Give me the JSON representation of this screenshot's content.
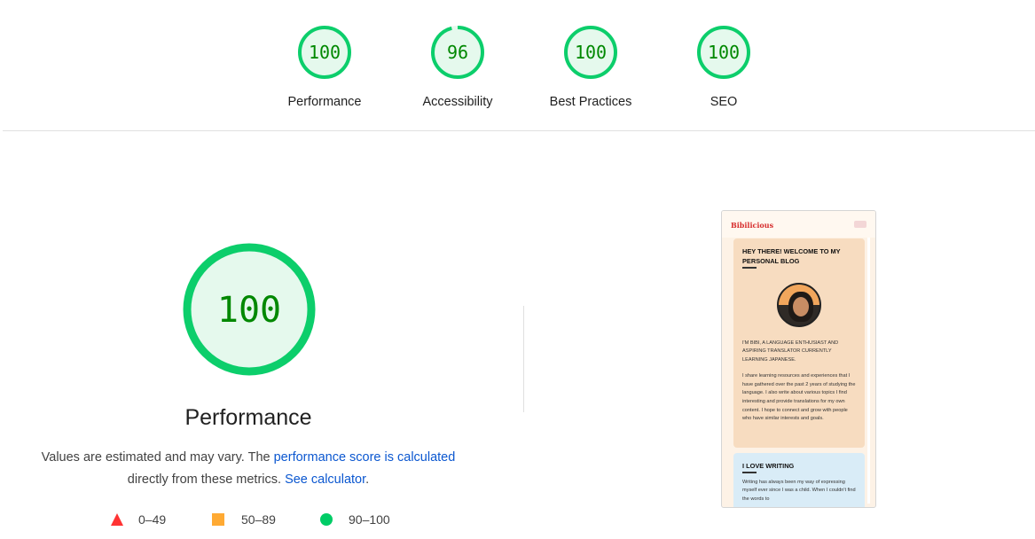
{
  "top_scores": [
    {
      "label": "Performance",
      "score": "100",
      "value": 100
    },
    {
      "label": "Accessibility",
      "score": "96",
      "value": 96
    },
    {
      "label": "Best Practices",
      "score": "100",
      "value": 100
    },
    {
      "label": "SEO",
      "score": "100",
      "value": 100
    }
  ],
  "main": {
    "score": "100",
    "value": 100,
    "title": "Performance",
    "desc_prefix": "Values are estimated and may vary. The ",
    "desc_link1": "performance score is calculated",
    "desc_middle": " directly from these metrics. ",
    "desc_link2": "See calculator",
    "desc_suffix": "."
  },
  "legend": {
    "fail": "0–49",
    "average": "50–89",
    "pass": "90–100"
  },
  "colors": {
    "pass": "#0cce6b",
    "pass_bg": "#e5f9ed",
    "pass_text": "#008800",
    "fail": "#ff3333",
    "average": "#ffaa33",
    "link": "#0b57d0"
  },
  "screenshot": {
    "logo": "Bibilicious",
    "card1_title": "HEY THERE! WELCOME TO MY PERSONAL BLOG",
    "card1_intro": "I'M BIBI, A LANGUAGE ENTHUSIAST AND ASPIRING TRANSLATOR CURRENTLY LEARNING JAPANESE.",
    "card1_body": "I share learning resources and experiences that I have gathered over the past 2 years of studying the language. I also write about various topics I find interesting and provide translations for my own content. I hope to connect and grow with people who have similar interests and goals.",
    "card2_title": "I LOVE WRITING",
    "card2_body": "Writing has always been my way of expressing myself ever since I was a child. When I couldn't find the words to"
  }
}
